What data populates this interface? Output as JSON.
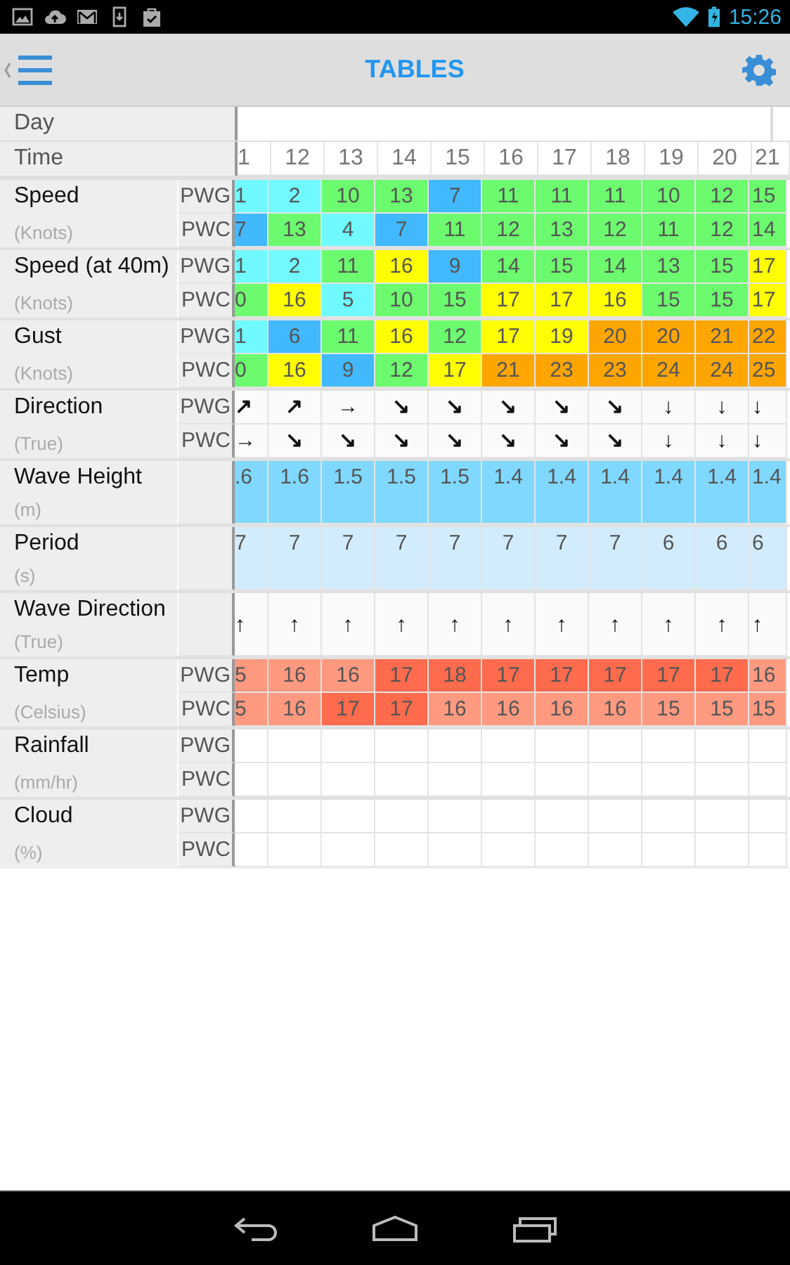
{
  "status_bar": {
    "time": "15:26"
  },
  "app_bar": {
    "title": "TABLES"
  },
  "table": {
    "day_label": "Day",
    "time_label": "Time",
    "hours": [
      "1",
      "12",
      "13",
      "14",
      "15",
      "16",
      "17",
      "18",
      "19",
      "20",
      "21"
    ],
    "groups": [
      {
        "label": "Speed",
        "unit": "(Knots)",
        "rows": [
          {
            "code": "PWG",
            "cells": [
              {
                "text": "1",
                "color": "#70faff"
              },
              {
                "text": "2",
                "color": "#70faff"
              },
              {
                "text": "10",
                "color": "#6cfa6e"
              },
              {
                "text": "13",
                "color": "#6cfa6e"
              },
              {
                "text": "7",
                "color": "#42b8ff"
              },
              {
                "text": "11",
                "color": "#6cfa6e"
              },
              {
                "text": "11",
                "color": "#6cfa6e"
              },
              {
                "text": "11",
                "color": "#6cfa6e"
              },
              {
                "text": "10",
                "color": "#6cfa6e"
              },
              {
                "text": "12",
                "color": "#6cfa6e"
              },
              {
                "text": "15",
                "color": "#6cfa6e"
              }
            ]
          },
          {
            "code": "PWC",
            "cells": [
              {
                "text": "7",
                "color": "#42b8ff"
              },
              {
                "text": "13",
                "color": "#6cfa6e"
              },
              {
                "text": "4",
                "color": "#70faff"
              },
              {
                "text": "7",
                "color": "#42b8ff"
              },
              {
                "text": "11",
                "color": "#6cfa6e"
              },
              {
                "text": "12",
                "color": "#6cfa6e"
              },
              {
                "text": "13",
                "color": "#6cfa6e"
              },
              {
                "text": "12",
                "color": "#6cfa6e"
              },
              {
                "text": "11",
                "color": "#6cfa6e"
              },
              {
                "text": "12",
                "color": "#6cfa6e"
              },
              {
                "text": "14",
                "color": "#6cfa6e"
              }
            ]
          }
        ]
      },
      {
        "label": "Speed (at 40m)",
        "unit": "(Knots)",
        "rows": [
          {
            "code": "PWG",
            "cells": [
              {
                "text": "1",
                "color": "#70faff"
              },
              {
                "text": "2",
                "color": "#70faff"
              },
              {
                "text": "11",
                "color": "#6cfa6e"
              },
              {
                "text": "16",
                "color": "#ffff00"
              },
              {
                "text": "9",
                "color": "#42b8ff"
              },
              {
                "text": "14",
                "color": "#6cfa6e"
              },
              {
                "text": "15",
                "color": "#6cfa6e"
              },
              {
                "text": "14",
                "color": "#6cfa6e"
              },
              {
                "text": "13",
                "color": "#6cfa6e"
              },
              {
                "text": "15",
                "color": "#6cfa6e"
              },
              {
                "text": "17",
                "color": "#ffff00"
              }
            ]
          },
          {
            "code": "PWC",
            "cells": [
              {
                "text": "0",
                "color": "#6cfa6e"
              },
              {
                "text": "16",
                "color": "#ffff00"
              },
              {
                "text": "5",
                "color": "#70faff"
              },
              {
                "text": "10",
                "color": "#6cfa6e"
              },
              {
                "text": "15",
                "color": "#6cfa6e"
              },
              {
                "text": "17",
                "color": "#ffff00"
              },
              {
                "text": "17",
                "color": "#ffff00"
              },
              {
                "text": "16",
                "color": "#ffff00"
              },
              {
                "text": "15",
                "color": "#6cfa6e"
              },
              {
                "text": "15",
                "color": "#6cfa6e"
              },
              {
                "text": "17",
                "color": "#ffff00"
              }
            ]
          }
        ]
      },
      {
        "label": "Gust",
        "unit": "(Knots)",
        "rows": [
          {
            "code": "PWG",
            "cells": [
              {
                "text": "1",
                "color": "#70faff"
              },
              {
                "text": "6",
                "color": "#42b8ff"
              },
              {
                "text": "11",
                "color": "#6cfa6e"
              },
              {
                "text": "16",
                "color": "#ffff00"
              },
              {
                "text": "12",
                "color": "#6cfa6e"
              },
              {
                "text": "17",
                "color": "#ffff00"
              },
              {
                "text": "19",
                "color": "#ffff00"
              },
              {
                "text": "20",
                "color": "#ffa500"
              },
              {
                "text": "20",
                "color": "#ffa500"
              },
              {
                "text": "21",
                "color": "#ffa500"
              },
              {
                "text": "22",
                "color": "#ffa500"
              }
            ]
          },
          {
            "code": "PWC",
            "cells": [
              {
                "text": "0",
                "color": "#6cfa6e"
              },
              {
                "text": "16",
                "color": "#ffff00"
              },
              {
                "text": "9",
                "color": "#42b8ff"
              },
              {
                "text": "12",
                "color": "#6cfa6e"
              },
              {
                "text": "17",
                "color": "#ffff00"
              },
              {
                "text": "21",
                "color": "#ffa500"
              },
              {
                "text": "23",
                "color": "#ffa500"
              },
              {
                "text": "23",
                "color": "#ffa500"
              },
              {
                "text": "24",
                "color": "#ffa500"
              },
              {
                "text": "24",
                "color": "#ffa500"
              },
              {
                "text": "25",
                "color": "#ffa500"
              }
            ]
          }
        ]
      },
      {
        "label": "Direction",
        "unit": "(True)",
        "rows": [
          {
            "code": "PWG",
            "kind": "arrow",
            "cells": [
              {
                "text": "↗"
              },
              {
                "text": "↗"
              },
              {
                "text": "→"
              },
              {
                "text": "↘"
              },
              {
                "text": "↘"
              },
              {
                "text": "↘"
              },
              {
                "text": "↘"
              },
              {
                "text": "↘"
              },
              {
                "text": "↓"
              },
              {
                "text": "↓"
              },
              {
                "text": "↓"
              }
            ]
          },
          {
            "code": "PWC",
            "kind": "arrow",
            "cells": [
              {
                "text": "→"
              },
              {
                "text": "↘"
              },
              {
                "text": "↘"
              },
              {
                "text": "↘"
              },
              {
                "text": "↘"
              },
              {
                "text": "↘"
              },
              {
                "text": "↘"
              },
              {
                "text": "↘"
              },
              {
                "text": "↓"
              },
              {
                "text": "↓"
              },
              {
                "text": "↓"
              }
            ]
          }
        ]
      },
      {
        "label": "Wave Height",
        "unit": "(m)",
        "rows": [
          {
            "kind": "tall",
            "cells": [
              {
                "text": ".6",
                "color": "#80d8ff"
              },
              {
                "text": "1.6",
                "color": "#80d8ff"
              },
              {
                "text": "1.5",
                "color": "#80d8ff"
              },
              {
                "text": "1.5",
                "color": "#80d8ff"
              },
              {
                "text": "1.5",
                "color": "#80d8ff"
              },
              {
                "text": "1.4",
                "color": "#80d8ff"
              },
              {
                "text": "1.4",
                "color": "#80d8ff"
              },
              {
                "text": "1.4",
                "color": "#80d8ff"
              },
              {
                "text": "1.4",
                "color": "#80d8ff"
              },
              {
                "text": "1.4",
                "color": "#80d8ff"
              },
              {
                "text": "1.4",
                "color": "#80d8ff"
              }
            ]
          }
        ]
      },
      {
        "label": "Period",
        "unit": "(s)",
        "rows": [
          {
            "kind": "tall",
            "cells": [
              {
                "text": "7",
                "color": "#d3ecfd"
              },
              {
                "text": "7",
                "color": "#d3ecfd"
              },
              {
                "text": "7",
                "color": "#d3ecfd"
              },
              {
                "text": "7",
                "color": "#d3ecfd"
              },
              {
                "text": "7",
                "color": "#d3ecfd"
              },
              {
                "text": "7",
                "color": "#d3ecfd"
              },
              {
                "text": "7",
                "color": "#d3ecfd"
              },
              {
                "text": "7",
                "color": "#d3ecfd"
              },
              {
                "text": "6",
                "color": "#d3ecfd"
              },
              {
                "text": "6",
                "color": "#d3ecfd"
              },
              {
                "text": "6",
                "color": "#d3ecfd"
              }
            ]
          }
        ]
      },
      {
        "label": "Wave Direction",
        "unit": "(True)",
        "rows": [
          {
            "kind": "tall-arrow",
            "cells": [
              {
                "text": "↑"
              },
              {
                "text": "↑"
              },
              {
                "text": "↑"
              },
              {
                "text": "↑"
              },
              {
                "text": "↑"
              },
              {
                "text": "↑"
              },
              {
                "text": "↑"
              },
              {
                "text": "↑"
              },
              {
                "text": "↑"
              },
              {
                "text": "↑"
              },
              {
                "text": "↑"
              }
            ]
          }
        ]
      },
      {
        "label": "Temp",
        "unit": "(Celsius)",
        "rows": [
          {
            "code": "PWG",
            "cells": [
              {
                "text": "5",
                "color": "#ff9a80"
              },
              {
                "text": "16",
                "color": "#ff9a80"
              },
              {
                "text": "16",
                "color": "#ff9a80"
              },
              {
                "text": "17",
                "color": "#ff6b4d"
              },
              {
                "text": "18",
                "color": "#ff6b4d"
              },
              {
                "text": "17",
                "color": "#ff6b4d"
              },
              {
                "text": "17",
                "color": "#ff6b4d"
              },
              {
                "text": "17",
                "color": "#ff6b4d"
              },
              {
                "text": "17",
                "color": "#ff6b4d"
              },
              {
                "text": "17",
                "color": "#ff6b4d"
              },
              {
                "text": "16",
                "color": "#ff9a80"
              }
            ]
          },
          {
            "code": "PWC",
            "cells": [
              {
                "text": "5",
                "color": "#ff9a80"
              },
              {
                "text": "16",
                "color": "#ff9a80"
              },
              {
                "text": "17",
                "color": "#ff6b4d"
              },
              {
                "text": "17",
                "color": "#ff6b4d"
              },
              {
                "text": "16",
                "color": "#ff9a80"
              },
              {
                "text": "16",
                "color": "#ff9a80"
              },
              {
                "text": "16",
                "color": "#ff9a80"
              },
              {
                "text": "16",
                "color": "#ff9a80"
              },
              {
                "text": "15",
                "color": "#ff9a80"
              },
              {
                "text": "15",
                "color": "#ff9a80"
              },
              {
                "text": "15",
                "color": "#ff9a80"
              }
            ]
          }
        ]
      },
      {
        "label": "Rainfall",
        "unit": "(mm/hr)",
        "rows": [
          {
            "code": "PWG"
          },
          {
            "code": "PWC"
          }
        ]
      },
      {
        "label": "Cloud",
        "unit": "(%)",
        "rows": [
          {
            "code": "PWG"
          },
          {
            "code": "PWC"
          }
        ]
      }
    ]
  }
}
